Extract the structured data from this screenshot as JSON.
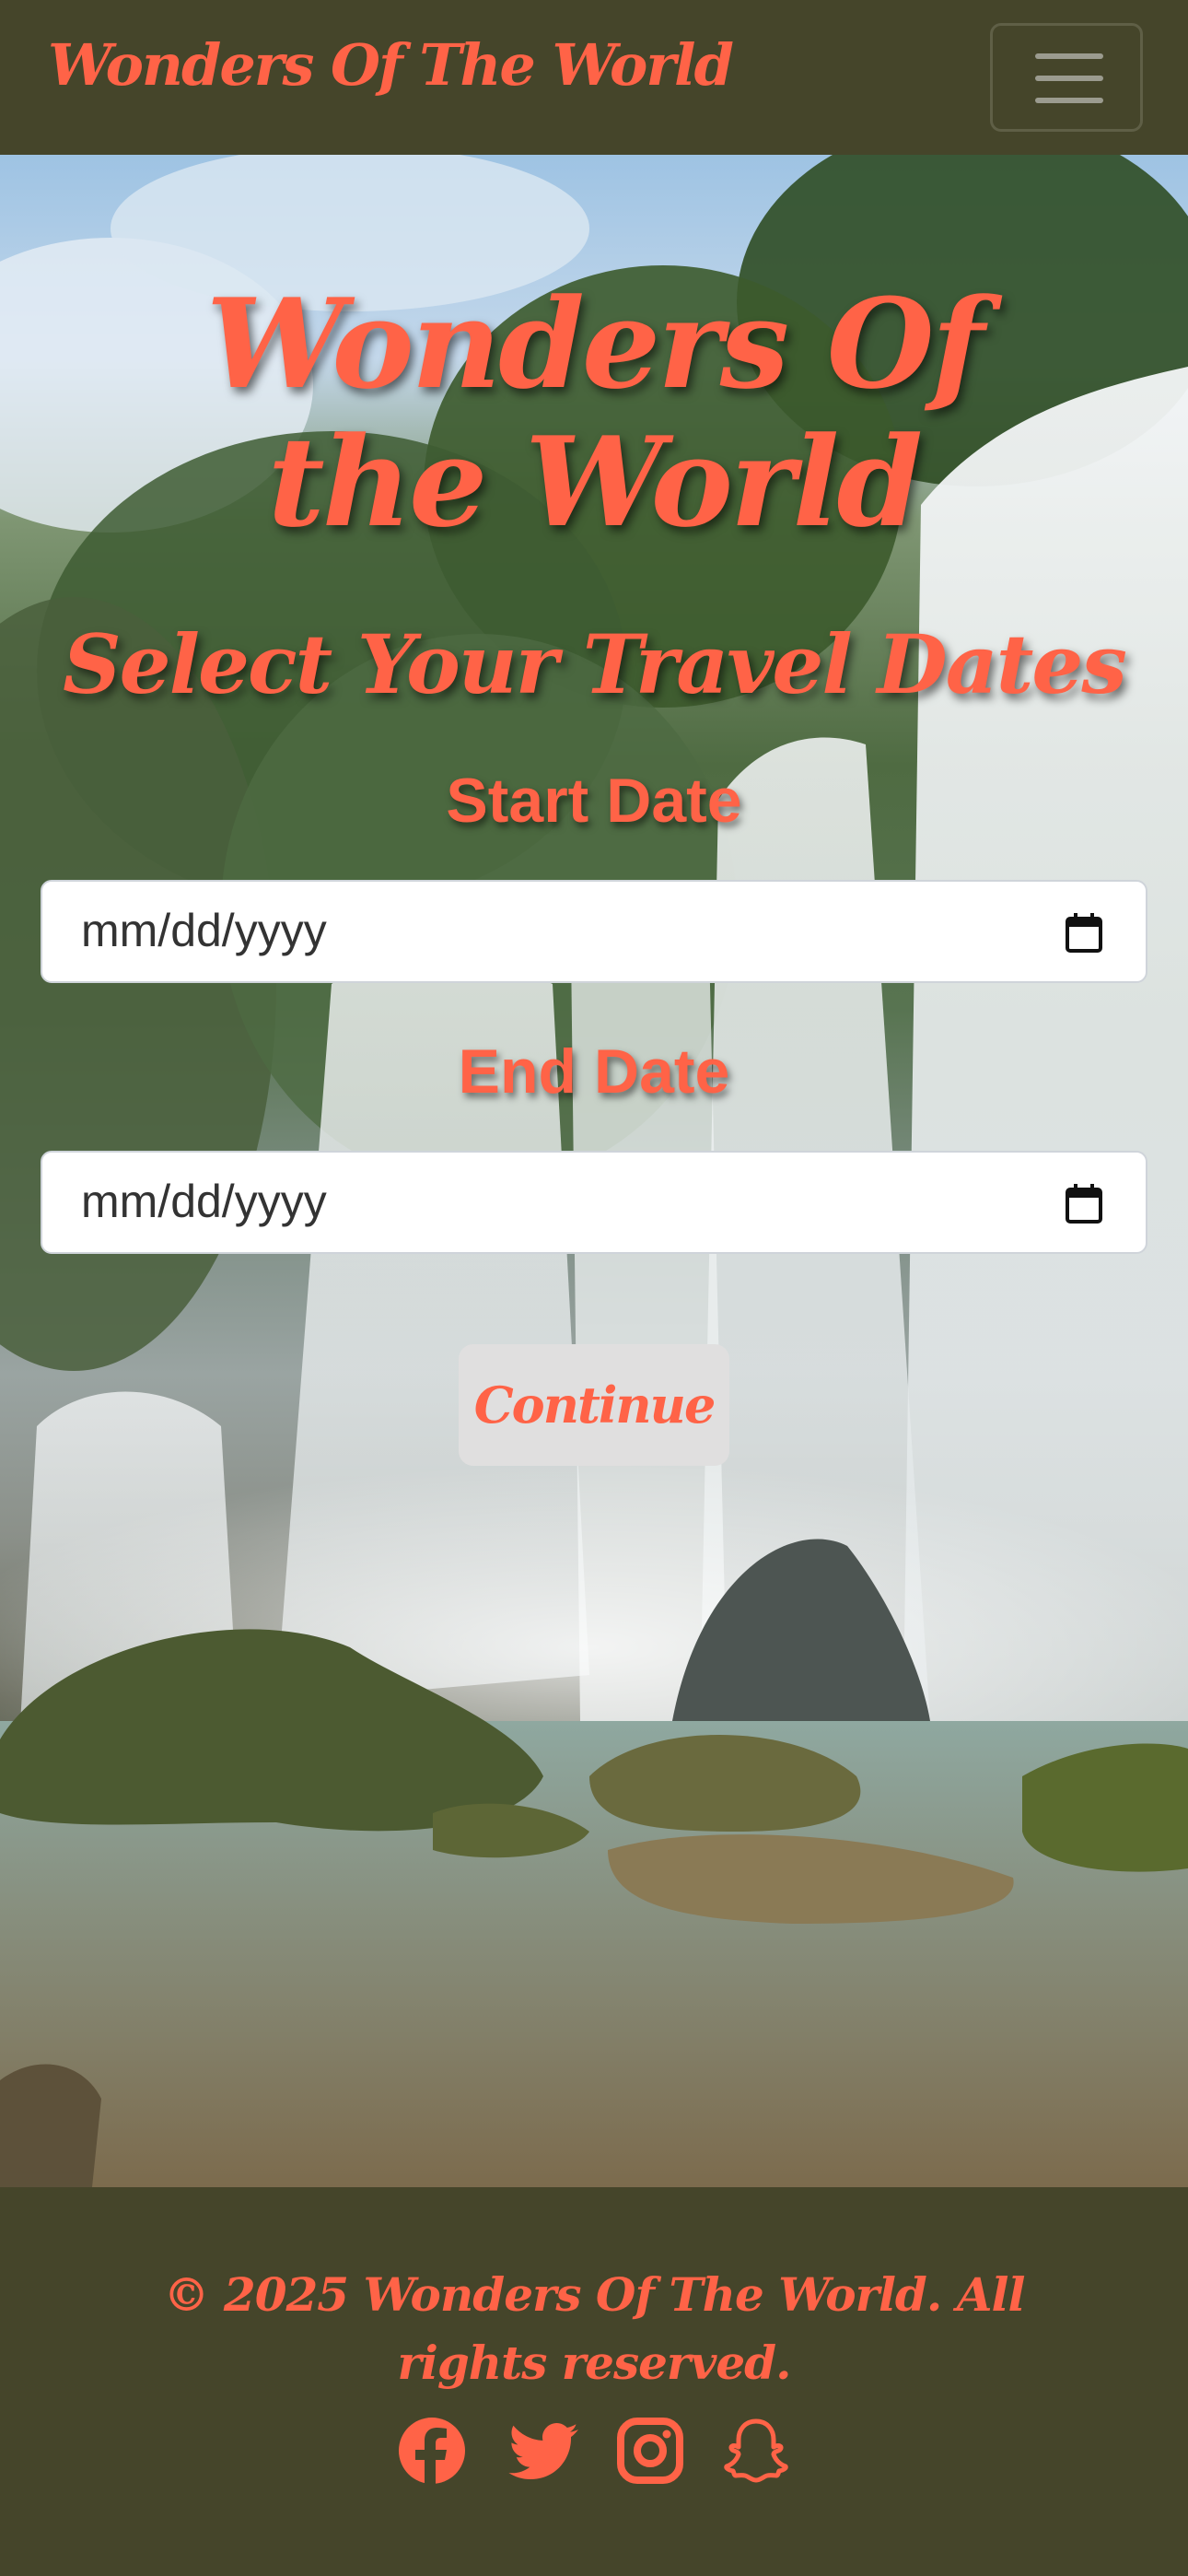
{
  "navbar": {
    "brand": "Wonders Of The World",
    "toggle_icon": "hamburger-menu-icon"
  },
  "hero": {
    "title": "Wonders Of the World",
    "subtitle": "Select Your Travel Dates",
    "start_label": "Start Date",
    "start_placeholder": "mm/dd/yyyy",
    "end_label": "End Date",
    "end_placeholder": "mm/dd/yyyy",
    "calendar_icon": "calendar-icon",
    "continue_label": "Continue"
  },
  "footer": {
    "copyright": "© 2025 Wonders Of The World. All rights reserved.",
    "social_icons": [
      "facebook-icon",
      "twitter-icon",
      "instagram-icon",
      "snapchat-icon"
    ]
  },
  "colors": {
    "accent": "#ff6347",
    "nav_footer_bg": "#45452a",
    "button_bg": "#e0dfdf"
  }
}
